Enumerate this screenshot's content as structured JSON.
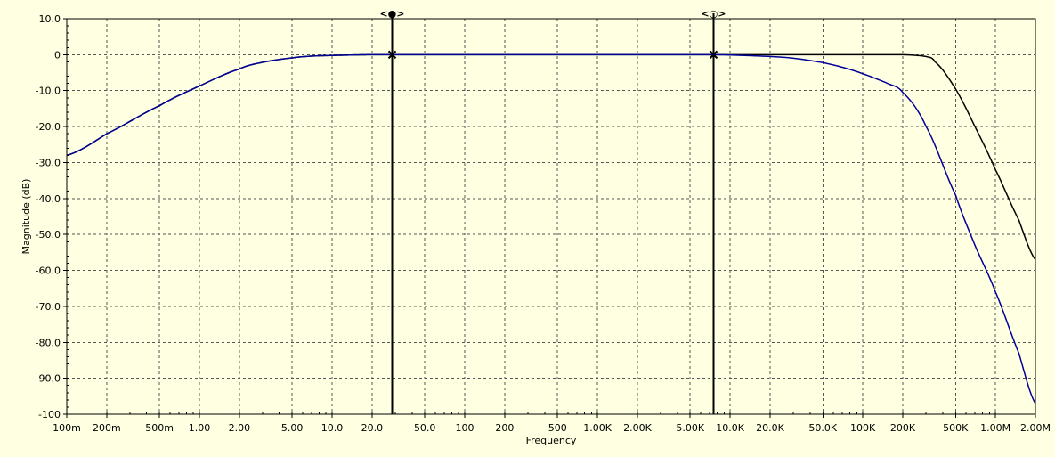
{
  "chart_data": {
    "type": "line",
    "xlabel": "Frequency",
    "ylabel": "Magnitude (dB)",
    "x_scale": "log",
    "xlim": [
      0.1,
      2000000
    ],
    "ylim": [
      -100,
      10
    ],
    "grid": true,
    "x_ticks": [
      {
        "value": 0.1,
        "label": "100m"
      },
      {
        "value": 0.2,
        "label": "200m"
      },
      {
        "value": 0.5,
        "label": "500m"
      },
      {
        "value": 1,
        "label": "1.00"
      },
      {
        "value": 2,
        "label": "2.00"
      },
      {
        "value": 5,
        "label": "5.00"
      },
      {
        "value": 10,
        "label": "10.0"
      },
      {
        "value": 20,
        "label": "20.0"
      },
      {
        "value": 50,
        "label": "50.0"
      },
      {
        "value": 100,
        "label": "100"
      },
      {
        "value": 200,
        "label": "200"
      },
      {
        "value": 500,
        "label": "500"
      },
      {
        "value": 1000,
        "label": "1.00K"
      },
      {
        "value": 2000,
        "label": "2.00K"
      },
      {
        "value": 5000,
        "label": "5.00K"
      },
      {
        "value": 10000,
        "label": "10.0K"
      },
      {
        "value": 20000,
        "label": "20.0K"
      },
      {
        "value": 50000,
        "label": "50.0K"
      },
      {
        "value": 100000,
        "label": "100K"
      },
      {
        "value": 200000,
        "label": "200K"
      },
      {
        "value": 500000,
        "label": "500K"
      },
      {
        "value": 1000000,
        "label": "1.00M"
      },
      {
        "value": 2000000,
        "label": "2.00M"
      }
    ],
    "y_ticks": [
      {
        "value": 10,
        "label": "10.0"
      },
      {
        "value": 0,
        "label": "0"
      },
      {
        "value": -10,
        "label": "-10.0"
      },
      {
        "value": -20,
        "label": "-20.0"
      },
      {
        "value": -30,
        "label": "-30.0"
      },
      {
        "value": -40,
        "label": "-40.0"
      },
      {
        "value": -50,
        "label": "-50.0"
      },
      {
        "value": -60,
        "label": "-60.0"
      },
      {
        "value": -70,
        "label": "-70.0"
      },
      {
        "value": -80,
        "label": "-80.0"
      },
      {
        "value": -90,
        "label": "-90.0"
      },
      {
        "value": -100,
        "label": "-100"
      }
    ],
    "series": [
      {
        "color": "#000000",
        "x": [
          0.1,
          0.2,
          0.5,
          1,
          2,
          3,
          5,
          7,
          10,
          20,
          50,
          100,
          1000,
          10000,
          100000,
          200000,
          300000,
          350000,
          500000,
          700000,
          1000000,
          1500000,
          2000000
        ],
        "y": [
          -28,
          -22,
          -14.2,
          -8.7,
          -4.0,
          -2.1,
          -0.9,
          -0.4,
          -0.2,
          0,
          0,
          0,
          0,
          0,
          0,
          0,
          -0.5,
          -2.0,
          -9.5,
          -20,
          -32,
          -46,
          -57
        ]
      },
      {
        "color": "#000099",
        "x": [
          0.1,
          0.2,
          0.5,
          1,
          2,
          3,
          5,
          7,
          10,
          20,
          50,
          100,
          1000,
          7000,
          10000,
          20000,
          30000,
          50000,
          70000,
          100000,
          150000,
          200000,
          300000,
          500000,
          700000,
          1000000,
          1500000,
          2000000
        ],
        "y": [
          -28,
          -22,
          -14.2,
          -8.7,
          -4.0,
          -2.1,
          -0.9,
          -0.4,
          -0.2,
          0,
          0,
          0,
          0,
          0,
          -0.1,
          -0.5,
          -1.0,
          -2.2,
          -3.5,
          -5.3,
          -7.8,
          -10.5,
          -20,
          -39,
          -53,
          -66,
          -83,
          -97
        ]
      }
    ],
    "cursors": [
      {
        "label": "<●>",
        "x": 28
      },
      {
        "label": "<○>",
        "x": 7500
      }
    ]
  }
}
